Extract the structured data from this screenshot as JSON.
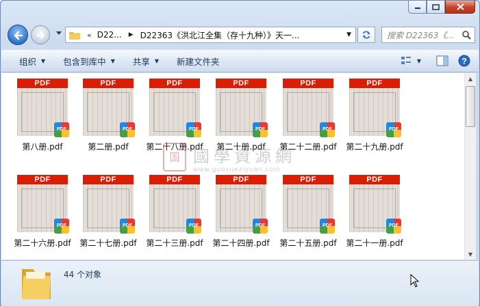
{
  "address": {
    "breadcrumb_prefix": "«",
    "crumb1": "D22...",
    "crumb2": "D22363《洪北江全集（存十九种）》天一..."
  },
  "search": {
    "placeholder": "搜索 D22363《..."
  },
  "toolbar": {
    "organize": "组织",
    "include_in_library": "包含到库中",
    "share": "共享",
    "new_folder": "新建文件夹"
  },
  "files": [
    {
      "name": "第八册.pdf",
      "thumb_label": "PDF",
      "badge": "PDF",
      "chars": ""
    },
    {
      "name": "第二册.pdf",
      "thumb_label": "PDF",
      "badge": "PDF",
      "chars": ""
    },
    {
      "name": "第二十八册.pdf",
      "thumb_label": "PDF",
      "badge": "PDF",
      "chars": ""
    },
    {
      "name": "第二十册.pdf",
      "thumb_label": "PDF",
      "badge": "PDF",
      "chars": ""
    },
    {
      "name": "第二十二册.pdf",
      "thumb_label": "PDF",
      "badge": "PDF",
      "chars": ""
    },
    {
      "name": "第二十九册.pdf",
      "thumb_label": "PDF",
      "badge": "PDF",
      "chars": ""
    },
    {
      "name": "第二十六册.pdf",
      "thumb_label": "PDF",
      "badge": "PDF",
      "chars": ""
    },
    {
      "name": "第二十七册.pdf",
      "thumb_label": "PDF",
      "badge": "PDF",
      "chars": ""
    },
    {
      "name": "第二十三册.pdf",
      "thumb_label": "PDF",
      "badge": "PDF",
      "chars": ""
    },
    {
      "name": "第二十四册.pdf",
      "thumb_label": "PDF",
      "badge": "PDF",
      "chars": ""
    },
    {
      "name": "第二十五册.pdf",
      "thumb_label": "PDF",
      "badge": "PDF",
      "chars": ""
    },
    {
      "name": "第二十一册.pdf",
      "thumb_label": "PDF",
      "badge": "PDF",
      "chars": ""
    }
  ],
  "watermark": {
    "seal": "国",
    "text": "國學資源網",
    "url": "www.guoxueziyuan.com"
  },
  "status": {
    "count": "44 个对象"
  },
  "colors": {
    "pdf_band": "#d81e06",
    "window_frame": "#6d8bb1",
    "toolbar_text": "#1e395b"
  }
}
